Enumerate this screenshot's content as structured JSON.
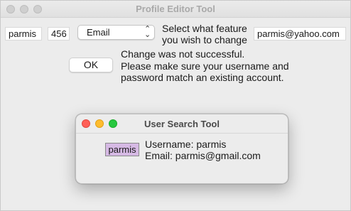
{
  "window": {
    "title": "Profile Editor Tool"
  },
  "form": {
    "username_value": "parmis",
    "password_value": "456",
    "feature_select_value": "Email",
    "feature_prompt_line1": "Select what feature",
    "feature_prompt_line2": "you wish to change",
    "new_value": "parmis@yahoo.com",
    "ok_label": "OK",
    "message_line1": "Change was not successful.",
    "message_line2": "Please make sure your username and",
    "message_line3": "password match an existing account."
  },
  "dialog": {
    "title": "User Search Tool",
    "search_value": "parmis",
    "username_line": "Username: parmis",
    "email_line": "Email: parmis@gmail.com"
  }
}
